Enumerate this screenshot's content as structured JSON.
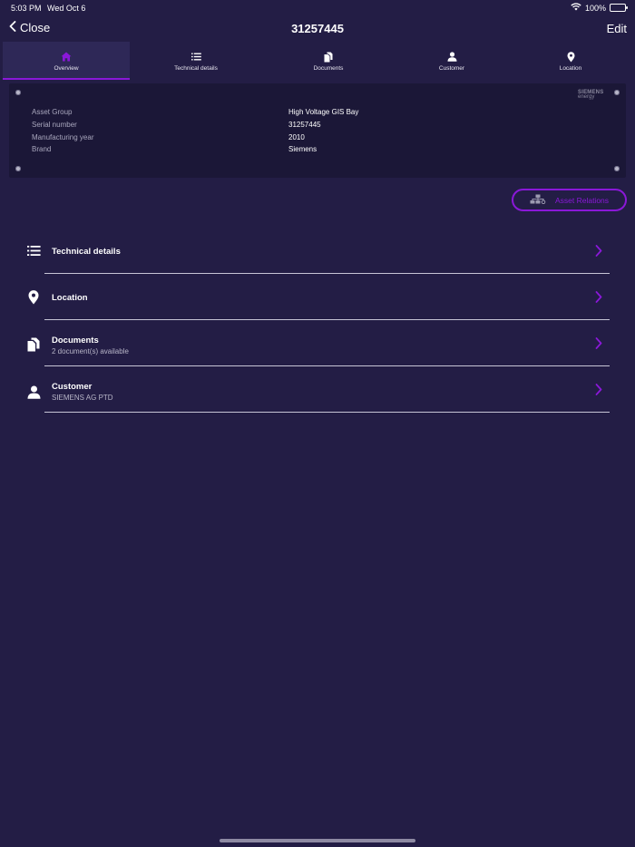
{
  "status": {
    "time": "5:03 PM",
    "date": "Wed Oct 6",
    "battery": "100%",
    "battery_level": 1.0
  },
  "nav": {
    "back_label": "Close",
    "title": "31257445",
    "edit_label": "Edit"
  },
  "tabs": [
    {
      "label": "Overview",
      "icon": "home-icon",
      "active": true
    },
    {
      "label": "Technical details",
      "icon": "list-icon",
      "active": false
    },
    {
      "label": "Documents",
      "icon": "documents-icon",
      "active": false
    },
    {
      "label": "Customer",
      "icon": "person-icon",
      "active": false
    },
    {
      "label": "Location",
      "icon": "location-pin-icon",
      "active": false
    }
  ],
  "asset": {
    "logo_line1": "SIEMENS",
    "logo_line2": "energy",
    "rows": [
      {
        "label": "Asset Group",
        "value": "High Voltage GIS Bay"
      },
      {
        "label": "Serial number",
        "value": "31257445"
      },
      {
        "label": "Manufacturing year",
        "value": "2010"
      },
      {
        "label": "Brand",
        "value": "Siemens"
      }
    ]
  },
  "relations_button": {
    "label": "Asset Relations",
    "icon": "hierarchy-icon"
  },
  "list": [
    {
      "title": "Technical details",
      "subtitle": "",
      "icon": "list-icon"
    },
    {
      "title": "Location",
      "subtitle": "",
      "icon": "location-pin-icon"
    },
    {
      "title": "Documents",
      "subtitle": "2 document(s) available",
      "icon": "documents-icon"
    },
    {
      "title": "Customer",
      "subtitle": "SIEMENS AG PTD",
      "icon": "person-icon"
    }
  ],
  "colors": {
    "background": "#231d45",
    "card": "#1b1737",
    "accent": "#8a18d8"
  }
}
